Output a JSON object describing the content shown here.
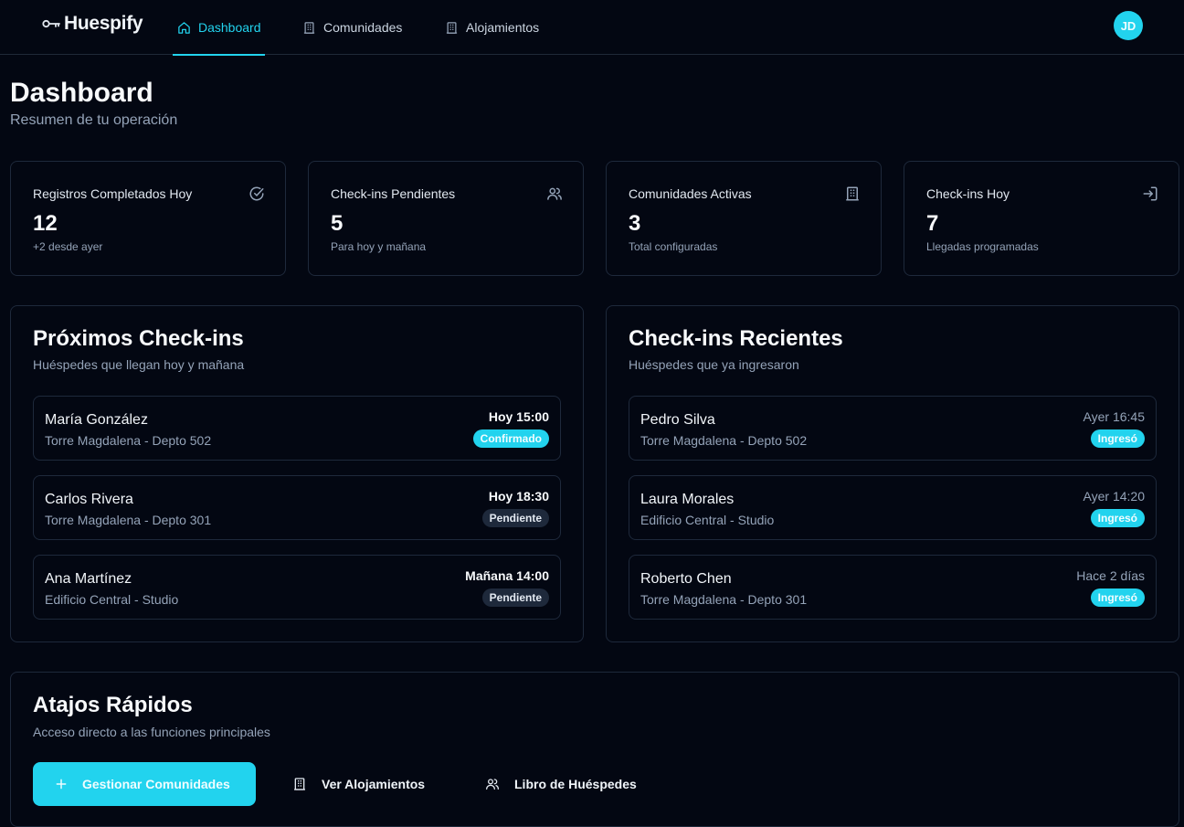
{
  "app": {
    "name": "Huespify"
  },
  "nav": {
    "tabs": [
      {
        "label": "Dashboard",
        "icon": "home-icon",
        "active": true
      },
      {
        "label": "Comunidades",
        "icon": "building-icon",
        "active": false
      },
      {
        "label": "Alojamientos",
        "icon": "building-icon",
        "active": false
      }
    ],
    "avatar": "JD"
  },
  "header": {
    "title": "Dashboard",
    "subtitle": "Resumen de tu operación"
  },
  "stats": [
    {
      "label": "Registros Completados Hoy",
      "value": "12",
      "note": "+2 desde ayer",
      "icon": "check-circle-icon"
    },
    {
      "label": "Check-ins Pendientes",
      "value": "5",
      "note": "Para hoy y mañana",
      "icon": "users-icon"
    },
    {
      "label": "Comunidades Activas",
      "value": "3",
      "note": "Total configuradas",
      "icon": "building-icon"
    },
    {
      "label": "Check-ins Hoy",
      "value": "7",
      "note": "Llegadas programadas",
      "icon": "login-icon"
    }
  ],
  "upcoming": {
    "title": "Próximos Check-ins",
    "subtitle": "Huéspedes que llegan hoy y mañana",
    "rows": [
      {
        "name": "María González",
        "location": "Torre Magdalena - Depto 502",
        "time": "Hoy 15:00",
        "status": "Confirmado"
      },
      {
        "name": "Carlos Rivera",
        "location": "Torre Magdalena - Depto 301",
        "time": "Hoy 18:30",
        "status": "Pendiente"
      },
      {
        "name": "Ana Martínez",
        "location": "Edificio Central - Studio",
        "time": "Mañana 14:00",
        "status": "Pendiente"
      }
    ]
  },
  "recent": {
    "title": "Check-ins Recientes",
    "subtitle": "Huéspedes que ya ingresaron",
    "rows": [
      {
        "name": "Pedro Silva",
        "location": "Torre Magdalena - Depto 502",
        "time": "Ayer 16:45",
        "status": "Ingresó"
      },
      {
        "name": "Laura Morales",
        "location": "Edificio Central - Studio",
        "time": "Ayer 14:20",
        "status": "Ingresó"
      },
      {
        "name": "Roberto Chen",
        "location": "Torre Magdalena - Depto 301",
        "time": "Hace 2 días",
        "status": "Ingresó"
      }
    ]
  },
  "shortcuts": {
    "title": "Atajos Rápidos",
    "subtitle": "Acceso directo a las funciones principales",
    "buttons": [
      {
        "label": "Gestionar Comunidades",
        "icon": "plus-icon"
      },
      {
        "label": "Ver Alojamientos",
        "icon": "building-icon"
      },
      {
        "label": "Libro de Huéspedes",
        "icon": "users-icon"
      }
    ]
  },
  "colors": {
    "accent": "#22d3ee",
    "background": "#030712",
    "border": "#1e293b",
    "muted": "#94a3b8"
  }
}
